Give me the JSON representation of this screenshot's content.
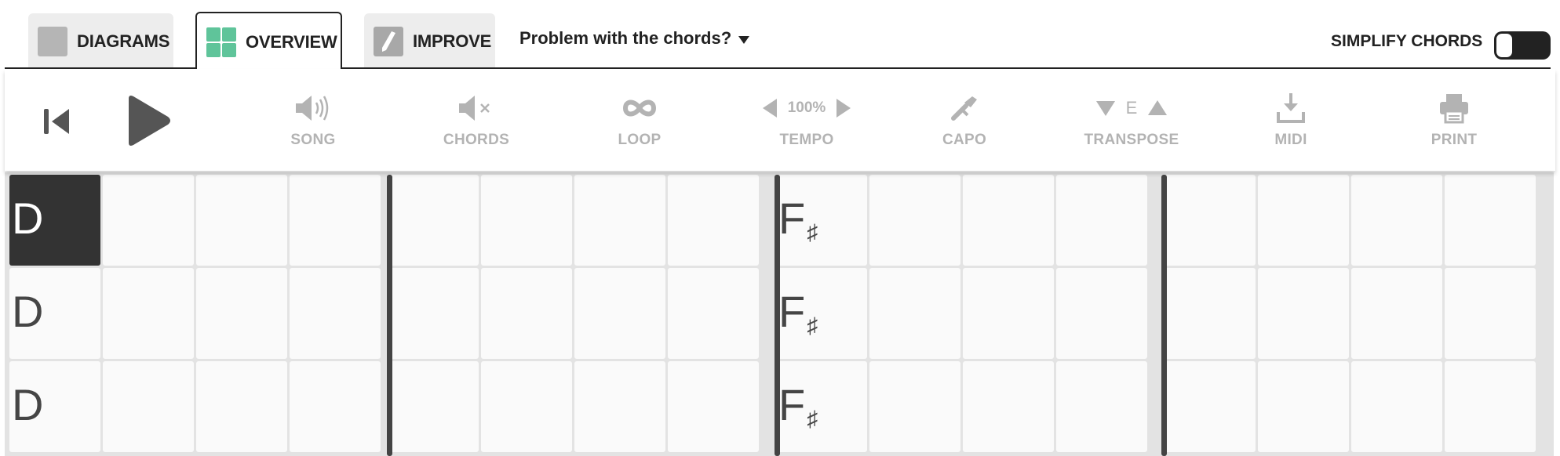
{
  "tabs": [
    {
      "id": "diagrams",
      "label": "DIAGRAMS",
      "icon": "diagrams-icon"
    },
    {
      "id": "overview",
      "label": "OVERVIEW",
      "icon": "grid-overview-icon",
      "active": true
    },
    {
      "id": "improve",
      "label": "IMPROVE",
      "icon": "pencil-icon"
    }
  ],
  "problem": {
    "label": "Problem with the chords?",
    "icon": "caret-down-icon"
  },
  "simplify": {
    "label": "SIMPLIFY CHORDS",
    "enabled": false
  },
  "toolbar": {
    "song": {
      "label": "SONG",
      "icon": "speaker-volume-icon"
    },
    "chords": {
      "label": "CHORDS",
      "icon": "speaker-mute-icon"
    },
    "loop": {
      "label": "LOOP",
      "icon": "infinity-loop-icon"
    },
    "tempo": {
      "label": "TEMPO",
      "value": "100%"
    },
    "capo": {
      "label": "CAPO",
      "icon": "capo-icon"
    },
    "transpose": {
      "label": "TRANSPOSE",
      "key": "E"
    },
    "midi": {
      "label": "MIDI",
      "icon": "download-icon"
    },
    "print": {
      "label": "PRINT",
      "icon": "printer-icon"
    }
  },
  "grid": {
    "rows": [
      {
        "chords": [
          {
            "root": "D",
            "acc": ""
          },
          {
            "root": "F",
            "acc": "♯"
          }
        ]
      },
      {
        "chords": [
          {
            "root": "D",
            "acc": ""
          },
          {
            "root": "F",
            "acc": "♯"
          }
        ]
      },
      {
        "chords": [
          {
            "root": "D",
            "acc": ""
          },
          {
            "root": "F",
            "acc": "♯"
          }
        ]
      }
    ],
    "selected_cell": "row 1, beat 1"
  },
  "colors": {
    "accent_green": "#5fc49a",
    "dark": "#333333",
    "muted": "#b3b3b3"
  }
}
